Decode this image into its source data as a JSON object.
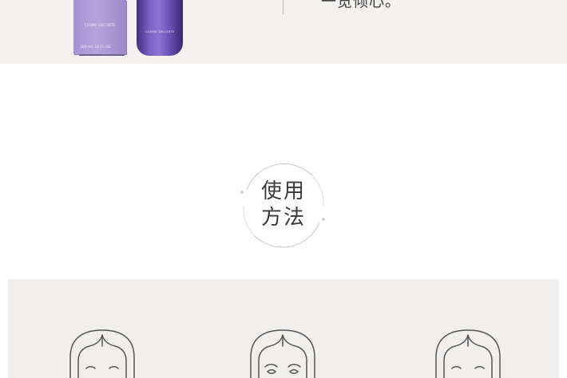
{
  "hero": {
    "product_box_brand": "COSME DECORTE",
    "product_box_volume": "300 mL 10 FL OZ",
    "bottle_brand": "COSME DECORTE",
    "caption": "一览倾心。"
  },
  "section": {
    "title_line1": "使用",
    "title_line2": "方法"
  },
  "steps": [
    {
      "illustration": "face-illustration-1"
    },
    {
      "illustration": "face-illustration-2"
    },
    {
      "illustration": "face-illustration-3"
    }
  ],
  "colors": {
    "band_bg": "#f3f2f0",
    "panel_bg": "#f0efed",
    "product_purple": "#8c76d1"
  }
}
